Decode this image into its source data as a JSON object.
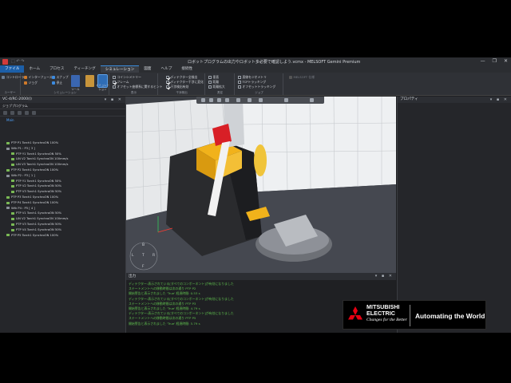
{
  "window": {
    "title": "ロボットプログラムの出力やロボット多必要で確認しよう.vcmx - MELSOFT Gemini Premium",
    "quick_access": "⬚ ↶ ↷",
    "controls": [
      "—",
      "❐",
      "✕"
    ]
  },
  "menu": [
    "ファイル",
    "ホーム",
    "プロセス",
    "ティーチング",
    "シミュレーション",
    "図面",
    "ヘルプ",
    "接続性"
  ],
  "ribbon": {
    "groups": [
      "ユーザー",
      "シミュレーション",
      "表示",
      "干渉検出",
      "測定",
      "ジョブ"
    ],
    "items_left": [
      "コントローラー",
      "インターフェース",
      "ジョグ",
      "スナップ",
      "停止",
      "ツール",
      "イミュレーション"
    ],
    "display_items": [
      "コインシメトリー",
      "フレーム",
      "オフセット座標系に関するヒント"
    ],
    "interference_items": [
      "ディテクター全検出",
      "ディテクター干渉に変化",
      "干渉検出有効"
    ],
    "measure_items": [
      "垂直",
      "距離",
      "距離拡大"
    ],
    "job_items": [
      "直線をジオメトリ",
      "TCPトラッキング",
      "オフセットトラッキング"
    ],
    "extra_button": "MELSOFT 仕様"
  },
  "left_panel": {
    "header": "VC-4/RC-2000(I)",
    "subheader": "ジョブプログラム",
    "main_node": "Main",
    "tree": [
      {
        "text": "PTP P1 Torch1 SynchroON 100%",
        "kind": "motion"
      },
      {
        "text": "Wtk P1 : P3 [ 3 ]",
        "kind": "cmd"
      },
      {
        "text": "PTP Y1 Torch1 SynchroON 50%",
        "kind": "motion"
      },
      {
        "text": "LIN V2 Torch1 SynchroON 100mm/s",
        "kind": "motion"
      },
      {
        "text": "LIN V3 Torch1 SynchroON 100mm/s",
        "kind": "motion"
      },
      {
        "text": "PTP P2 Torch1 SynchroON 100%",
        "kind": "motion"
      },
      {
        "text": "Wtk P2 : P3 [ 1 ]",
        "kind": "cmd"
      },
      {
        "text": "PTP Y1 Torch1 SynchroON 50%",
        "kind": "motion"
      },
      {
        "text": "PTP V2 Torch1 SynchroON 50%",
        "kind": "motion"
      },
      {
        "text": "PTP V3 Torch1 SynchroON 50%",
        "kind": "motion"
      },
      {
        "text": "PTP P3 Torch1 SynchroON 100%",
        "kind": "motion"
      },
      {
        "text": "PTP P4 Torch1 SynchroON 100%",
        "kind": "motion"
      },
      {
        "text": "Wtk P4 : P5 [ 4 ]",
        "kind": "cmd"
      },
      {
        "text": "PTP V1 Torch1 SynchroON 50%",
        "kind": "motion"
      },
      {
        "text": "LIN V2 Torch1 SynchroON 100mm/s",
        "kind": "motion"
      },
      {
        "text": "PTP V3 Torch1 SynchroON 50%",
        "kind": "motion"
      },
      {
        "text": "PTP V4 Torch1 SynchroON 50%",
        "kind": "motion"
      },
      {
        "text": "PTP P5 Torch1 SynchroON 100%",
        "kind": "motion"
      }
    ]
  },
  "viewport": {
    "nav_labels": [
      "B",
      "L",
      "T",
      "R",
      "F"
    ]
  },
  "output": {
    "title": "出力",
    "lines": [
      "ディテクター:表示されている[すべてのコンポーネント]が有効になりました",
      "ステートメントへの移動時間は次の通り PTP P2",
      "開始警告と表示されました 'True' 経過時間: 0.53 s",
      "ディテクター:表示されている[すべてのコンポーネント]が有効になりました",
      "ステートメントへの移動時間は次の通り PTP P3",
      "開始警告と表示されました 'True' 経過時間: 4.79 s",
      "ディテクター:表示されている[すべてのコンポーネント]が有効になりました",
      "ステートメントへの移動時間は次の通り PTP P5",
      "開始警告と表示されました 'True' 経過時間: 5.79 s"
    ]
  },
  "right_panel": {
    "header": "プロパティ"
  },
  "logo": {
    "brand_line1": "MITSUBISHI",
    "brand_line2": "ELECTRIC",
    "tagline": "Changes for the Better",
    "slogan": "Automating the World"
  },
  "colors": {
    "accent": "#2f6db5",
    "robot_yellow": "#f1b21b",
    "output_text": "#5fbf4e",
    "tree_link": "#4fa3ff"
  }
}
